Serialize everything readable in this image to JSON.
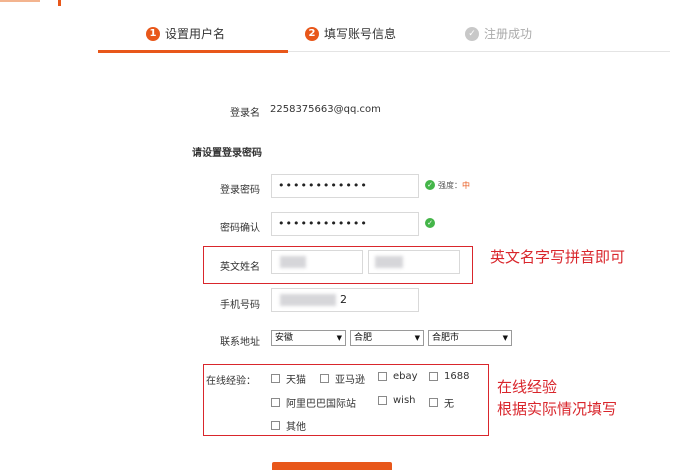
{
  "steps": [
    {
      "num": "1",
      "label": "设置用户名"
    },
    {
      "num": "2",
      "label": "填写账号信息"
    },
    {
      "label": "注册成功"
    }
  ],
  "form": {
    "login_name_label": "登录名",
    "login_name_value": "2258375663@qq.com",
    "section_title": "请设置登录密码",
    "password_label": "登录密码",
    "password_value": "••••••••••••",
    "strength_prefix": "强度：",
    "strength_level": "中",
    "confirm_label": "密码确认",
    "confirm_value": "••••••••••••",
    "english_name_label": "英文姓名",
    "phone_label": "手机号码",
    "phone_visible_tail": "2",
    "address_label": "联系地址",
    "address_province": "安徽",
    "address_city": "合肥",
    "address_district": "合肥市",
    "experience_label": "在线经验：",
    "experience_options": [
      "天猫",
      "亚马逊",
      "ebay",
      "1688",
      "阿里巴巴国际站",
      "wish",
      "无",
      "其他"
    ]
  },
  "annotations": {
    "name_note": "英文名字写拼音即可",
    "experience_note_line1": "在线经验",
    "experience_note_line2": "根据实际情况填写"
  },
  "colors": {
    "accent": "#e8571a",
    "annotation_red": "#d9262c",
    "success_green": "#44b549"
  },
  "icons": {
    "valid": "check-circle-icon",
    "step_done": "check-circle-icon"
  }
}
